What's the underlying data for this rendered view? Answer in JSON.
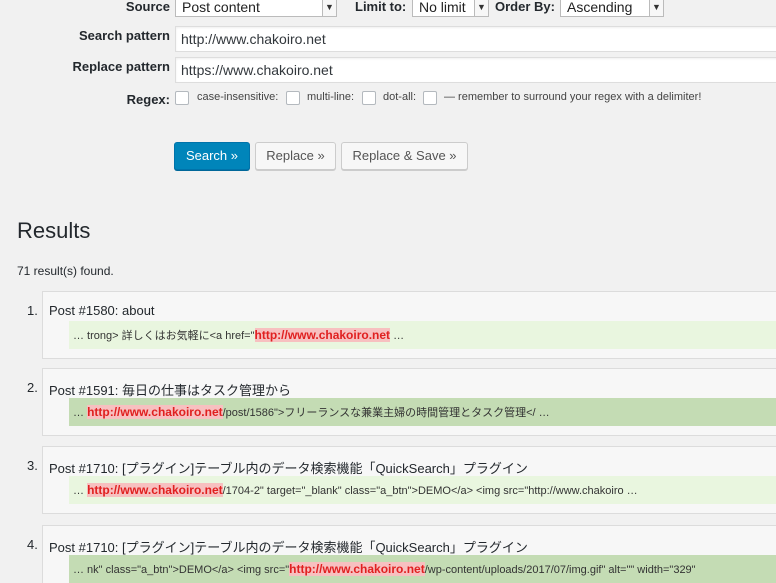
{
  "form": {
    "source_label": "Source",
    "source_value": "Post content",
    "limit_label": "Limit to:",
    "limit_value": "No limit",
    "order_label": "Order By:",
    "order_value": "Ascending",
    "search_label": "Search pattern",
    "search_value": "http://www.chakoiro.net",
    "replace_label": "Replace pattern",
    "replace_value": "https://www.chakoiro.net",
    "regex_label": "Regex:",
    "regex_options": [
      "case-insensitive:",
      "multi-line:",
      "dot-all:"
    ],
    "regex_note": "— remember to surround your regex with a delimiter!"
  },
  "buttons": {
    "search": "Search »",
    "replace": "Replace »",
    "replace_save": "Replace & Save »"
  },
  "results": {
    "heading": "Results",
    "count_text": "71 result(s) found.",
    "items": [
      {
        "num": "1.",
        "title": "Post #1580: about",
        "pre": "… trong> 詳しくはお気軽に<a href=\"",
        "match": "http://www.chakoiro.net",
        "post": " …"
      },
      {
        "num": "2.",
        "title": "Post #1591: 毎日の仕事はタスク管理から",
        "pre": "… ",
        "match": "http://www.chakoiro.net",
        "post": "/post/1586\">フリーランスな兼業主婦の時間管理とタスク管理</ …"
      },
      {
        "num": "3.",
        "title": "Post #1710: [プラグイン]テーブル内のデータ検索機能「QuickSearch」プラグイン",
        "pre": "… ",
        "match": "http://www.chakoiro.net",
        "post": "/1704-2\" target=\"_blank\" class=\"a_btn\">DEMO</a> <img src=\"http://www.chakoiro …"
      },
      {
        "num": "4.",
        "title": "Post #1710: [プラグイン]テーブル内のデータ検索機能「QuickSearch」プラグイン",
        "pre": "… nk\" class=\"a_btn\">DEMO</a> <img src=\"",
        "match": "http://www.chakoiro.net",
        "post": "/wp-content/uploads/2017/07/img.gif\" alt=\"\" width=\"329\""
      }
    ]
  },
  "colors": {
    "primary_button": "#0085ba",
    "match_highlight_bg": "#f7c0c0",
    "match_highlight_text": "#e02020",
    "snippet_light": "#e9f6df",
    "snippet_dark": "#c4dcb4"
  }
}
